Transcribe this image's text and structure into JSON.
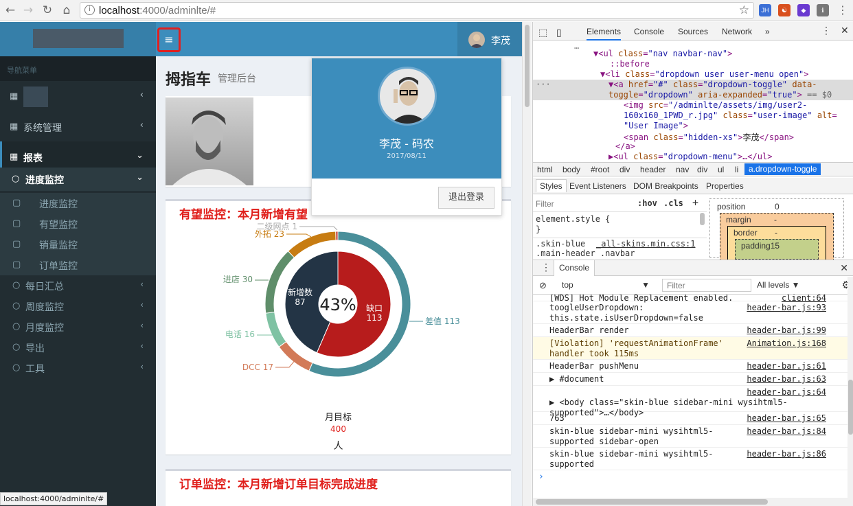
{
  "browser": {
    "url_host": "localhost",
    "url_path": ":4000/adminlte/#",
    "extensions": [
      "JH",
      "☯",
      "◆",
      "ℹ"
    ]
  },
  "colors": {
    "primary": "#3c8dbc",
    "sidebar": "#222d32",
    "danger": "#e0201c"
  },
  "topbar": {
    "user_name": "李茂"
  },
  "sidebar": {
    "header": "导航菜单",
    "sys": "系统管理",
    "report": "报表",
    "progress": "进度监控",
    "subs": [
      "进度监控",
      "有望监控",
      "销量监控",
      "订单监控"
    ],
    "groups": [
      "每日汇总",
      "周度监控",
      "月度监控",
      "导出",
      "工具"
    ]
  },
  "page": {
    "title": "拇指车",
    "subtitle": "管理后台"
  },
  "card1": {
    "title": "有望监控：本月新增有望"
  },
  "card2": {
    "title": "订单监控：本月新增订单目标完成进度"
  },
  "chart_data": {
    "type": "pie",
    "center_label": "43%",
    "inner": [
      {
        "name": "新增数",
        "value": 87
      },
      {
        "name": "缺口",
        "value": 113
      }
    ],
    "outer": [
      {
        "name": "二级网点",
        "value": 1
      },
      {
        "name": "外拓",
        "value": 23
      },
      {
        "name": "进店",
        "value": 30
      },
      {
        "name": "电话",
        "value": 16
      },
      {
        "name": "DCC",
        "value": 17
      },
      {
        "name": "差值",
        "value": 113
      }
    ],
    "target_label": "月目标",
    "target_value": "400",
    "target_unit": "人"
  },
  "dropdown": {
    "name": "李茂 - 码农",
    "date": "2017/08/11",
    "logout": "退出登录"
  },
  "status_url": "localhost:4000/adminlte/#",
  "devtools": {
    "tabs": [
      "Elements",
      "Console",
      "Sources",
      "Network",
      "»"
    ],
    "crumbs": [
      "html",
      "body",
      "#root",
      "div",
      "header",
      "nav",
      "div",
      "ul",
      "li",
      "a.dropdown-toggle"
    ],
    "sub_tabs": [
      "Styles",
      "Event Listeners",
      "DOM Breakpoints",
      "Properties"
    ],
    "filter": "Filter",
    "hov": ":hov",
    "cls": ".cls",
    "style_rule": "element.style {",
    "style_close": "}",
    "skin_sel": ".skin-blue",
    "skin_sel2": ".main-header .navbar",
    "skin_src": "_all-skins.min.css:1",
    "box": {
      "position": "position",
      "pos_val": "0",
      "margin": "margin",
      "margin_val": "-",
      "border": "border",
      "border_val": "-",
      "padding": "padding15"
    },
    "console_tab": "Console",
    "context": "top",
    "levels": "All levels ▼",
    "prompt": "›",
    "el_before": "::before"
  },
  "console": [
    {
      "msg": "[WDS] Hot Module Replacement enabled.",
      "src": "client:64"
    },
    {
      "msg": "toogleUserDropdown:\nthis.state.isUserDropdown=false",
      "src": "header-bar.js:93"
    },
    {
      "msg": "HeaderBar render",
      "src": "header-bar.js:99"
    },
    {
      "msg": "[Violation] 'requestAnimationFrame'\nhandler took 115ms",
      "src": "Animation.js:168"
    },
    {
      "msg": "HeaderBar pushMenu",
      "src": "header-bar.js:61"
    },
    {
      "msg": "▶ #document",
      "src": "header-bar.js:63"
    },
    {
      "msg": "\n▶ <body class=\"skin-blue sidebar-mini wysihtml5-\nsupported\">…</body>",
      "src": "header-bar.js:64"
    },
    {
      "msg": "763",
      "src": "header-bar.js:65"
    },
    {
      "msg": "skin-blue sidebar-mini wysihtml5-\nsupported sidebar-open",
      "src": "header-bar.js:84"
    },
    {
      "msg": "skin-blue sidebar-mini wysihtml5-\nsupported",
      "src": "header-bar.js:86"
    }
  ]
}
